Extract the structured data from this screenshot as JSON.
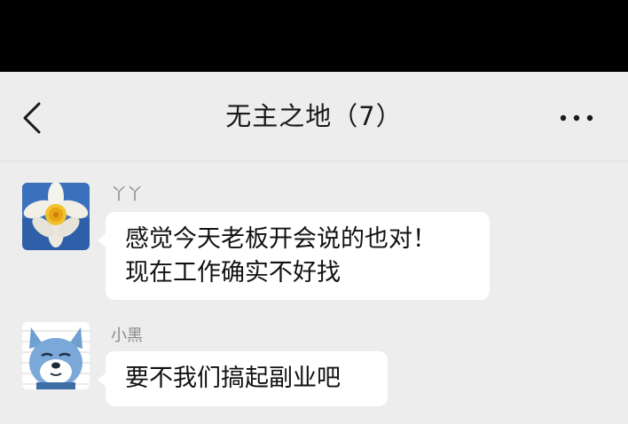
{
  "header": {
    "title": "无主之地（7）",
    "back_icon": "chevron-left-icon",
    "more_icon": "more-dots-icon"
  },
  "messages": [
    {
      "sender": "丫丫",
      "avatar": "daffodil-avatar",
      "lines": [
        "感觉今天老板开会说的也对！",
        "现在工作确实不好找"
      ]
    },
    {
      "sender": "小黑",
      "avatar": "shiba-dog-avatar",
      "lines": [
        "要不我们搞起副业吧"
      ]
    }
  ],
  "colors": {
    "background": "#ededed",
    "bubble": "#ffffff",
    "status_bar": "#000000"
  }
}
